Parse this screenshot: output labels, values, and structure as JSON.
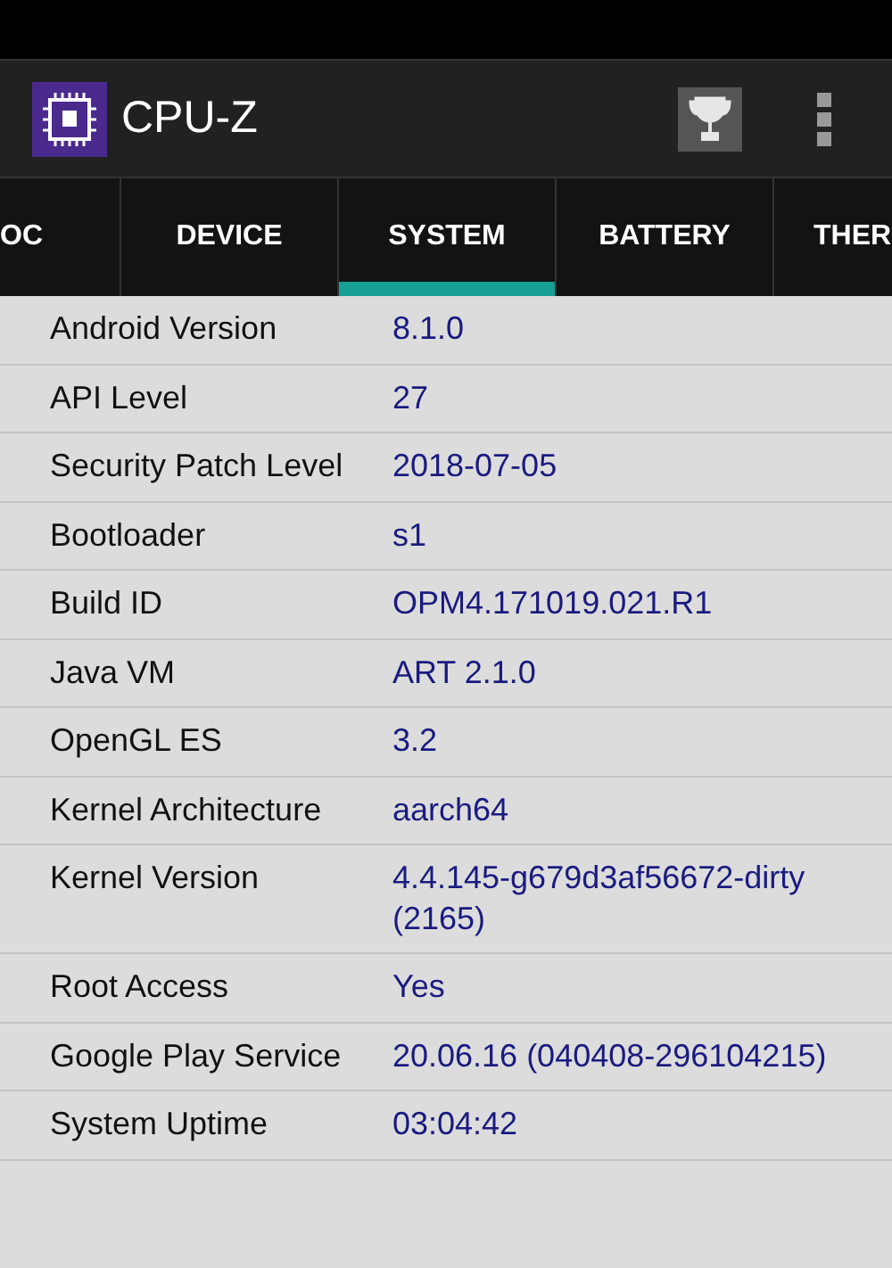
{
  "app_bar": {
    "title": "CPU-Z"
  },
  "tabs": [
    {
      "label": "OC",
      "selected": false
    },
    {
      "label": "DEVICE",
      "selected": false
    },
    {
      "label": "SYSTEM",
      "selected": true
    },
    {
      "label": "BATTERY",
      "selected": false
    },
    {
      "label": "THER",
      "selected": false
    }
  ],
  "rows": [
    {
      "label": "Android Version",
      "value": "8.1.0"
    },
    {
      "label": "API Level",
      "value": "27"
    },
    {
      "label": "Security Patch Level",
      "value": "2018-07-05"
    },
    {
      "label": "Bootloader",
      "value": "s1"
    },
    {
      "label": "Build ID",
      "value": "OPM4.171019.021.R1"
    },
    {
      "label": "Java VM",
      "value": "ART 2.1.0"
    },
    {
      "label": "OpenGL ES",
      "value": "3.2"
    },
    {
      "label": "Kernel Architecture",
      "value": "aarch64"
    },
    {
      "label": "Kernel Version",
      "value": "4.4.145-g679d3af56672-dirty (2165)"
    },
    {
      "label": "Root Access",
      "value": "Yes"
    },
    {
      "label": "Google Play Service",
      "value": "20.06.16 (040408-296104215)"
    },
    {
      "label": "System Uptime",
      "value": "03:04:42"
    }
  ]
}
